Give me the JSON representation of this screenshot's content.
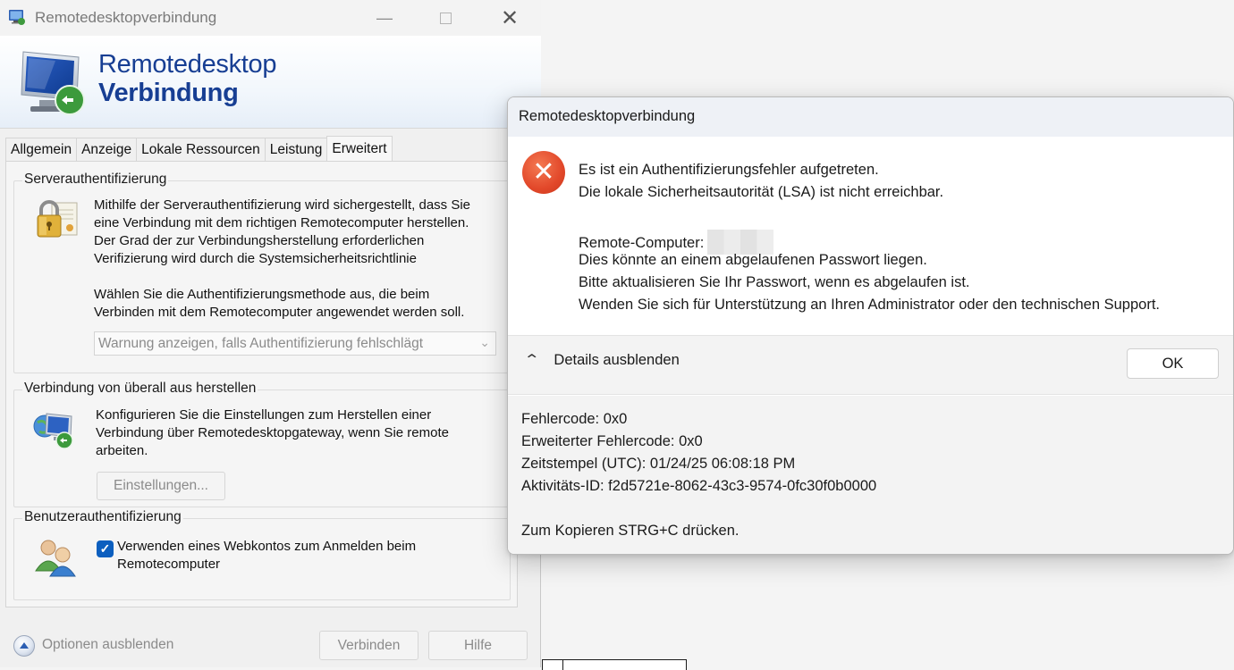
{
  "main_window": {
    "title": "Remotedesktopverbindung",
    "banner": {
      "line1": "Remotedesktop",
      "line2": "Verbindung"
    },
    "tabs": [
      {
        "label": "Allgemein"
      },
      {
        "label": "Anzeige"
      },
      {
        "label": "Lokale Ressourcen"
      },
      {
        "label": "Leistung"
      },
      {
        "label": "Erweitert",
        "active": true
      }
    ],
    "server_auth": {
      "heading": "Serverauthentifizierung",
      "lines": [
        "Mithilfe der Serverauthentifizierung wird sichergestellt, dass Sie",
        "eine Verbindung mit dem richtigen Remotecomputer herstellen.",
        "Der Grad der zur Verbindungsherstellung erforderlichen",
        "Verifizierung wird durch die Systemsicherheitsrichtlinie"
      ],
      "lines2": [
        "Wählen Sie die Authentifizierungsmethode aus, die beim",
        "Verbinden mit dem Remotecomputer angewendet werden soll."
      ],
      "select_value": "Warnung anzeigen, falls Authentifizierung fehlschlägt"
    },
    "gateway": {
      "heading": "Verbindung von überall aus herstellen",
      "lines": [
        "Konfigurieren Sie die Einstellungen zum Herstellen einer",
        "Verbindung über Remotedesktopgateway, wenn Sie remote",
        "arbeiten."
      ],
      "settings_button": "Einstellungen..."
    },
    "user_auth": {
      "heading": "Benutzerauthentifizierung",
      "checkbox_checked": true,
      "lines": [
        "Verwenden eines Webkontos zum Anmelden beim",
        "Remotecomputer"
      ]
    },
    "bottom": {
      "options_label": "Optionen ausblenden",
      "connect_button": "Verbinden",
      "help_button": "Hilfe"
    }
  },
  "error_dialog": {
    "title": "Remotedesktopverbindung",
    "messages": [
      "Es ist ein Authentifizierungsfehler aufgetreten.",
      "Die lokale Sicherheitsautorität (LSA) ist nicht erreichbar."
    ],
    "remote_computer_label": "Remote-Computer:",
    "messages2": [
      "Dies könnte an einem abgelaufenen Passwort liegen.",
      "Bitte aktualisieren Sie Ihr Passwort, wenn es abgelaufen ist.",
      "Wenden Sie sich für Unterstützung an Ihren Administrator oder den technischen Support."
    ],
    "details_toggle": "Details ausblenden",
    "ok_button": "OK",
    "details": [
      "Fehlercode: 0x0",
      "Erweiterter Fehlercode: 0x0",
      "Zeitstempel (UTC): 01/24/25 06:08:18 PM",
      "Aktivitäts-ID: f2d5721e-8062-43c3-9574-0fc30f0b0000"
    ],
    "copy_hint": "Zum Kopieren STRG+C drücken."
  },
  "colors": {
    "banner_text": "#173e93",
    "error_red": "#e2482a",
    "checkbox_blue": "#0c5fbf"
  },
  "icons": [
    "rdp-app-icon",
    "minimize-icon",
    "maximize-icon",
    "close-icon",
    "rdp-monitor-icon",
    "padlock-icon",
    "globe-monitor-icon",
    "users-icon",
    "checkmark-icon",
    "chevron-up-icon",
    "chevron-down-icon",
    "error-icon"
  ]
}
